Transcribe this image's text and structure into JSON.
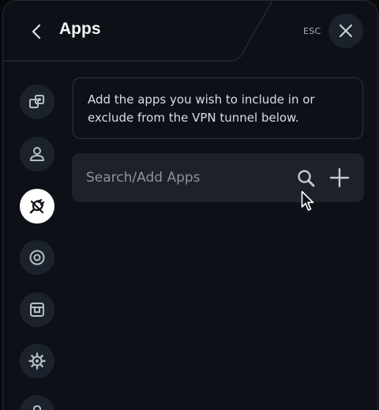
{
  "header": {
    "title": "Apps",
    "esc_label": "ESC",
    "back_icon": "chevron-left-icon",
    "close_icon": "close-icon"
  },
  "sidebar": {
    "items": [
      {
        "name": "split-tunnel-icon",
        "active": false
      },
      {
        "name": "account-icon",
        "active": false
      },
      {
        "name": "apps-plug-icon",
        "active": true
      },
      {
        "name": "privacy-icon",
        "active": false
      },
      {
        "name": "storage-icon",
        "active": false
      },
      {
        "name": "settings-gear-icon",
        "active": false
      },
      {
        "name": "lock-icon",
        "active": false
      }
    ]
  },
  "main": {
    "info_text": "Add the apps you wish to include in or exclude from the VPN tunnel below.",
    "search": {
      "value": "",
      "placeholder": "Search/Add Apps"
    }
  },
  "colors": {
    "background": "#0d1117",
    "control": "#1c222b",
    "active": "#ffffff",
    "border": "#2c333d"
  }
}
